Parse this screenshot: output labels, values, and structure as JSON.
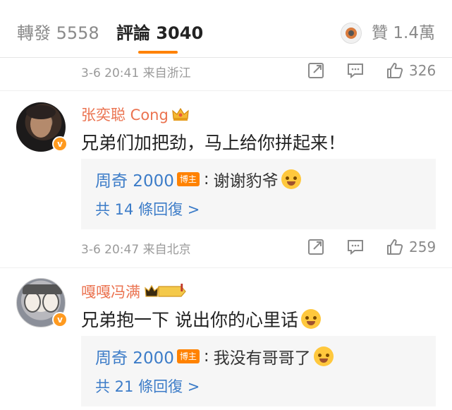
{
  "tabs": {
    "repost_label": "轉發 5558",
    "comments_label": "評論 3040",
    "likes_label": "贊 1.4萬"
  },
  "posts": [
    {
      "time_location": "3-6 20:41 来自浙江",
      "like_count": "326"
    },
    {
      "username": "张奕聪 Cong",
      "text": "兄弟们加把劲，马上给你拼起来！",
      "reply": {
        "user": "周奇 2000",
        "badge": "博主",
        "colon": ":",
        "text": "谢谢豹爷"
      },
      "more_replies": "共 14 條回復 >",
      "time_location": "3-6 20:47 来自北京",
      "like_count": "259"
    },
    {
      "username": "嘎嘎冯满",
      "vip_level": "I",
      "text": "兄弟抱一下 说出你的心里话",
      "reply": {
        "user": "周奇 2000",
        "badge": "博主",
        "colon": ":",
        "text": "我没有哥哥了"
      },
      "more_replies": "共 21 條回復 >"
    }
  ],
  "icons": [
    "share-icon",
    "comment-icon",
    "thumbs-up-icon",
    "crown-icon",
    "vip-badge-icon",
    "crying-emoji-icon",
    "laughing-emoji-icon",
    "verified-badge-icon"
  ],
  "colors": {
    "accent": "#ff8200",
    "username": "#eb7350",
    "reply_link": "#3c7cc8"
  }
}
